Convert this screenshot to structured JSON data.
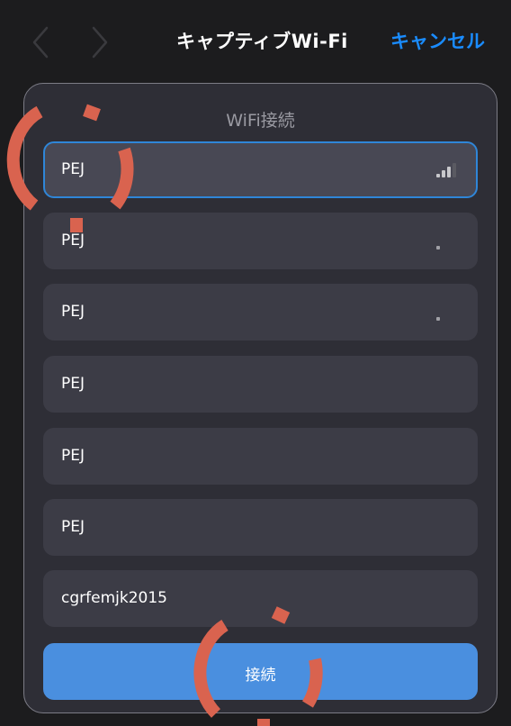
{
  "navbar": {
    "title": "キャプティブWi-Fi",
    "cancel_label": "キャンセル",
    "back_icon": "chevron-left-icon",
    "forward_icon": "chevron-right-icon"
  },
  "panel": {
    "title": "WiFi接続"
  },
  "networks": [
    {
      "name": "PEJ",
      "selected": true,
      "signal_bars": 3
    },
    {
      "name": "PEJ",
      "selected": false,
      "signal_bars": 1
    },
    {
      "name": "PEJ",
      "selected": false,
      "signal_bars": 1
    },
    {
      "name": "PEJ",
      "selected": false,
      "signal_bars": 0
    },
    {
      "name": "PEJ",
      "selected": false,
      "signal_bars": 0
    },
    {
      "name": "PEJ",
      "selected": false,
      "signal_bars": 0
    },
    {
      "name": "cgrfemjk2015",
      "selected": false,
      "signal_bars": 0
    }
  ],
  "connect_button": {
    "label": "接続"
  },
  "colors": {
    "accent": "#1a8cff",
    "button": "#4a8fdf",
    "selected_border": "#2f86d8",
    "annotation": "#d9634f"
  }
}
